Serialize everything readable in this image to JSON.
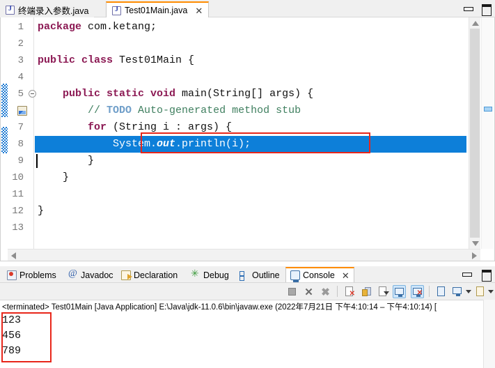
{
  "window": {
    "minimize_label": "Minimize",
    "maximize_label": "Maximize"
  },
  "editor_tabs": [
    {
      "label": "终端录入参数.java",
      "icon": "java-file-icon",
      "active": false,
      "closable": false
    },
    {
      "label": "Test01Main.java",
      "icon": "java-file-icon",
      "active": true,
      "closable": true,
      "close_glyph": "✕"
    }
  ],
  "editor": {
    "line_numbers": [
      "1",
      "2",
      "3",
      "4",
      "5",
      "6",
      "7",
      "8",
      "9",
      "10",
      "11",
      "12",
      "13"
    ],
    "highlighted_line": "8",
    "lines": [
      {
        "n": "1",
        "tokens": [
          {
            "t": "package",
            "c": "kw"
          },
          {
            "t": " com.ketang;",
            "c": "plain"
          }
        ]
      },
      {
        "n": "2",
        "tokens": []
      },
      {
        "n": "3",
        "tokens": [
          {
            "t": "public class",
            "c": "kw"
          },
          {
            "t": " Test01Main {",
            "c": "plain"
          }
        ]
      },
      {
        "n": "4",
        "tokens": []
      },
      {
        "n": "5",
        "tokens": [
          {
            "t": "    ",
            "c": "plain"
          },
          {
            "t": "public static void",
            "c": "kw"
          },
          {
            "t": " main(String[] args) {",
            "c": "plain"
          }
        ]
      },
      {
        "n": "6",
        "tokens": [
          {
            "t": "        // ",
            "c": "cmt"
          },
          {
            "t": "TODO",
            "c": "todo"
          },
          {
            "t": " Auto-generated method stub",
            "c": "cmt"
          }
        ]
      },
      {
        "n": "7",
        "tokens": [
          {
            "t": "        ",
            "c": "plain"
          },
          {
            "t": "for",
            "c": "kw"
          },
          {
            "t": " (String i : args) {",
            "c": "plain"
          }
        ]
      },
      {
        "n": "8",
        "tokens": [
          {
            "t": "            System.",
            "c": "plain"
          },
          {
            "t": "out",
            "c": "fld"
          },
          {
            "t": ".println(i);",
            "c": "plain"
          }
        ]
      },
      {
        "n": "9",
        "tokens": [
          {
            "t": "        }",
            "c": "plain"
          }
        ]
      },
      {
        "n": "10",
        "tokens": [
          {
            "t": "    }",
            "c": "plain"
          }
        ]
      },
      {
        "n": "11",
        "tokens": []
      },
      {
        "n": "12",
        "tokens": [
          {
            "t": "}",
            "c": "plain"
          }
        ]
      },
      {
        "n": "13",
        "tokens": []
      }
    ],
    "markers": {
      "fold_line": "5",
      "todo_task_line": "6"
    },
    "colors": {
      "keyword": "#8c1a54",
      "comment": "#3f7f5f",
      "todo_tag": "#6f9ec9",
      "selection": "#0d7fd9",
      "annotation_box": "#e8261a",
      "change_bar": "#1877d2"
    }
  },
  "annotations": [
    {
      "name": "code-highlight-box",
      "color": "#e8261a",
      "target": "System.out.println(i);"
    },
    {
      "name": "console-output-box",
      "color": "#e8261a",
      "target": "123 456 789"
    }
  ],
  "view_tabs": [
    {
      "label": "Problems",
      "icon": "problems-icon",
      "active": false
    },
    {
      "label": "Javadoc",
      "icon": "javadoc-icon",
      "active": false
    },
    {
      "label": "Declaration",
      "icon": "declaration-icon",
      "active": false
    },
    {
      "label": "Debug",
      "icon": "debug-icon",
      "active": false
    },
    {
      "label": "Outline",
      "icon": "outline-icon",
      "active": false
    },
    {
      "label": "Console",
      "icon": "console-icon",
      "active": true,
      "closable": true,
      "close_glyph": "✕"
    }
  ],
  "console_toolbar": [
    {
      "name": "terminate-button",
      "tooltip": "Terminate",
      "selected": false
    },
    {
      "name": "remove-launch-button",
      "tooltip": "Remove Launch",
      "selected": false
    },
    {
      "name": "remove-all-terminated-button",
      "tooltip": "Remove All Terminated Launches",
      "selected": false
    },
    {
      "name": "clear-console-button",
      "tooltip": "Clear Console",
      "selected": false
    },
    {
      "name": "scroll-lock-button",
      "tooltip": "Scroll Lock",
      "selected": false
    },
    {
      "name": "word-wrap-button",
      "tooltip": "Word Wrap",
      "selected": false
    },
    {
      "name": "show-console-on-output-button",
      "tooltip": "Show Console When Standard Out Changes",
      "selected": true
    },
    {
      "name": "show-console-on-error-button",
      "tooltip": "Show Console When Standard Error Changes",
      "selected": true
    },
    {
      "name": "pin-console-button",
      "tooltip": "Pin Console",
      "selected": false
    },
    {
      "name": "display-selected-console-button",
      "tooltip": "Display Selected Console",
      "selected": false
    },
    {
      "name": "open-console-button",
      "tooltip": "Open Console",
      "selected": false
    }
  ],
  "console": {
    "status_line": "<terminated> Test01Main [Java Application] E:\\Java\\jdk-11.0.6\\bin\\javaw.exe  (2022年7月21日 下午4:10:14 – 下午4:10:14) [",
    "output_lines": [
      "123",
      "456",
      "789"
    ]
  }
}
